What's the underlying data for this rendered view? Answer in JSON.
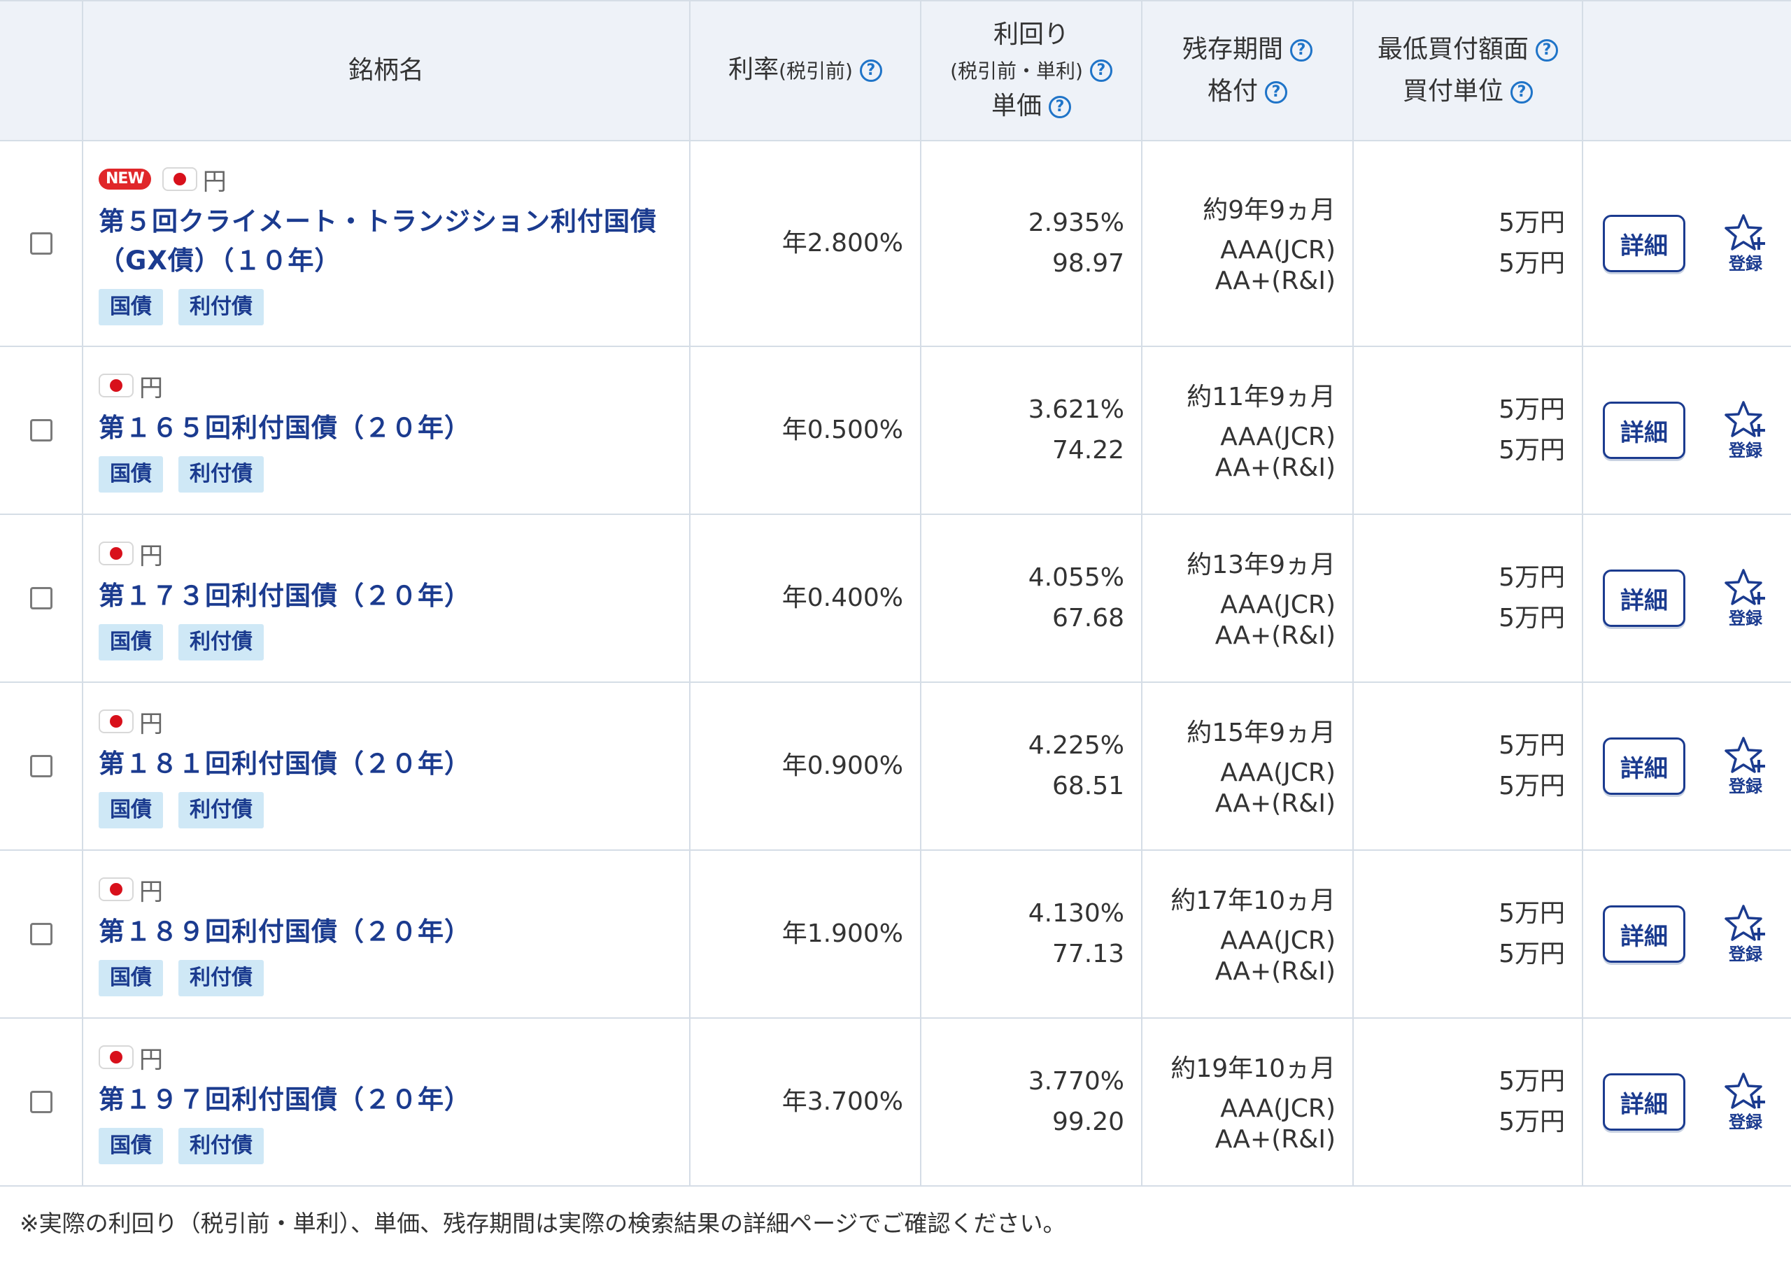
{
  "header": {
    "name": "銘柄名",
    "rate": "利率",
    "rate_sub": "(税引前)",
    "yield_line1": "利回り",
    "yield_line2": "(税引前・単利)",
    "price": "単価",
    "maturity": "残存期間",
    "rating": "格付",
    "min_amount": "最低買付額面",
    "unit": "買付単位",
    "help_glyph": "?"
  },
  "new_label": "NEW",
  "currency": "円",
  "detail_label": "詳細",
  "favorite_label": "登録",
  "rows": [
    {
      "name_line1": "第５回クライメート・トランジション利付国債",
      "name_line2": "（GX債）（１０年）",
      "tag1": "国債",
      "tag2": "利付債",
      "rate": "年2.800%",
      "yield": "2.935%",
      "price": "98.97",
      "maturity": "約9年9ヵ月",
      "rating1": "AAA(JCR)",
      "rating2": "AA+(R&I)",
      "min_amount": "5万円",
      "unit": "5万円"
    },
    {
      "name_line1": "第１６５回利付国債（２０年）",
      "tag1": "国債",
      "tag2": "利付債",
      "rate": "年0.500%",
      "yield": "3.621%",
      "price": "74.22",
      "maturity": "約11年9ヵ月",
      "rating1": "AAA(JCR)",
      "rating2": "AA+(R&I)",
      "min_amount": "5万円",
      "unit": "5万円"
    },
    {
      "name_line1": "第１７３回利付国債（２０年）",
      "tag1": "国債",
      "tag2": "利付債",
      "rate": "年0.400%",
      "yield": "4.055%",
      "price": "67.68",
      "maturity": "約13年9ヵ月",
      "rating1": "AAA(JCR)",
      "rating2": "AA+(R&I)",
      "min_amount": "5万円",
      "unit": "5万円"
    },
    {
      "name_line1": "第１８１回利付国債（２０年）",
      "tag1": "国債",
      "tag2": "利付債",
      "rate": "年0.900%",
      "yield": "4.225%",
      "price": "68.51",
      "maturity": "約15年9ヵ月",
      "rating1": "AAA(JCR)",
      "rating2": "AA+(R&I)",
      "min_amount": "5万円",
      "unit": "5万円"
    },
    {
      "name_line1": "第１８９回利付国債（２０年）",
      "tag1": "国債",
      "tag2": "利付債",
      "rate": "年1.900%",
      "yield": "4.130%",
      "price": "77.13",
      "maturity": "約17年10ヵ月",
      "rating1": "AAA(JCR)",
      "rating2": "AA+(R&I)",
      "min_amount": "5万円",
      "unit": "5万円"
    },
    {
      "name_line1": "第１９７回利付国債（２０年）",
      "tag1": "国債",
      "tag2": "利付債",
      "rate": "年3.700%",
      "yield": "3.770%",
      "price": "99.20",
      "maturity": "約19年10ヵ月",
      "rating1": "AAA(JCR)",
      "rating2": "AA+(R&I)",
      "min_amount": "5万円",
      "unit": "5万円"
    }
  ],
  "footnote": "※実際の利回り（税引前・単利）、単価、残存期間は実際の検索結果の詳細ページでご確認ください。",
  "colors": {
    "accent": "#1b3b8f",
    "help": "#1f74c8",
    "tag_bg": "#cfe8f6",
    "header_bg": "#eef2f8",
    "new_badge": "#e0272a"
  },
  "icons": {
    "help": "question-circle-icon",
    "flag": "japan-flag-icon",
    "favorite": "star-plus-icon"
  }
}
